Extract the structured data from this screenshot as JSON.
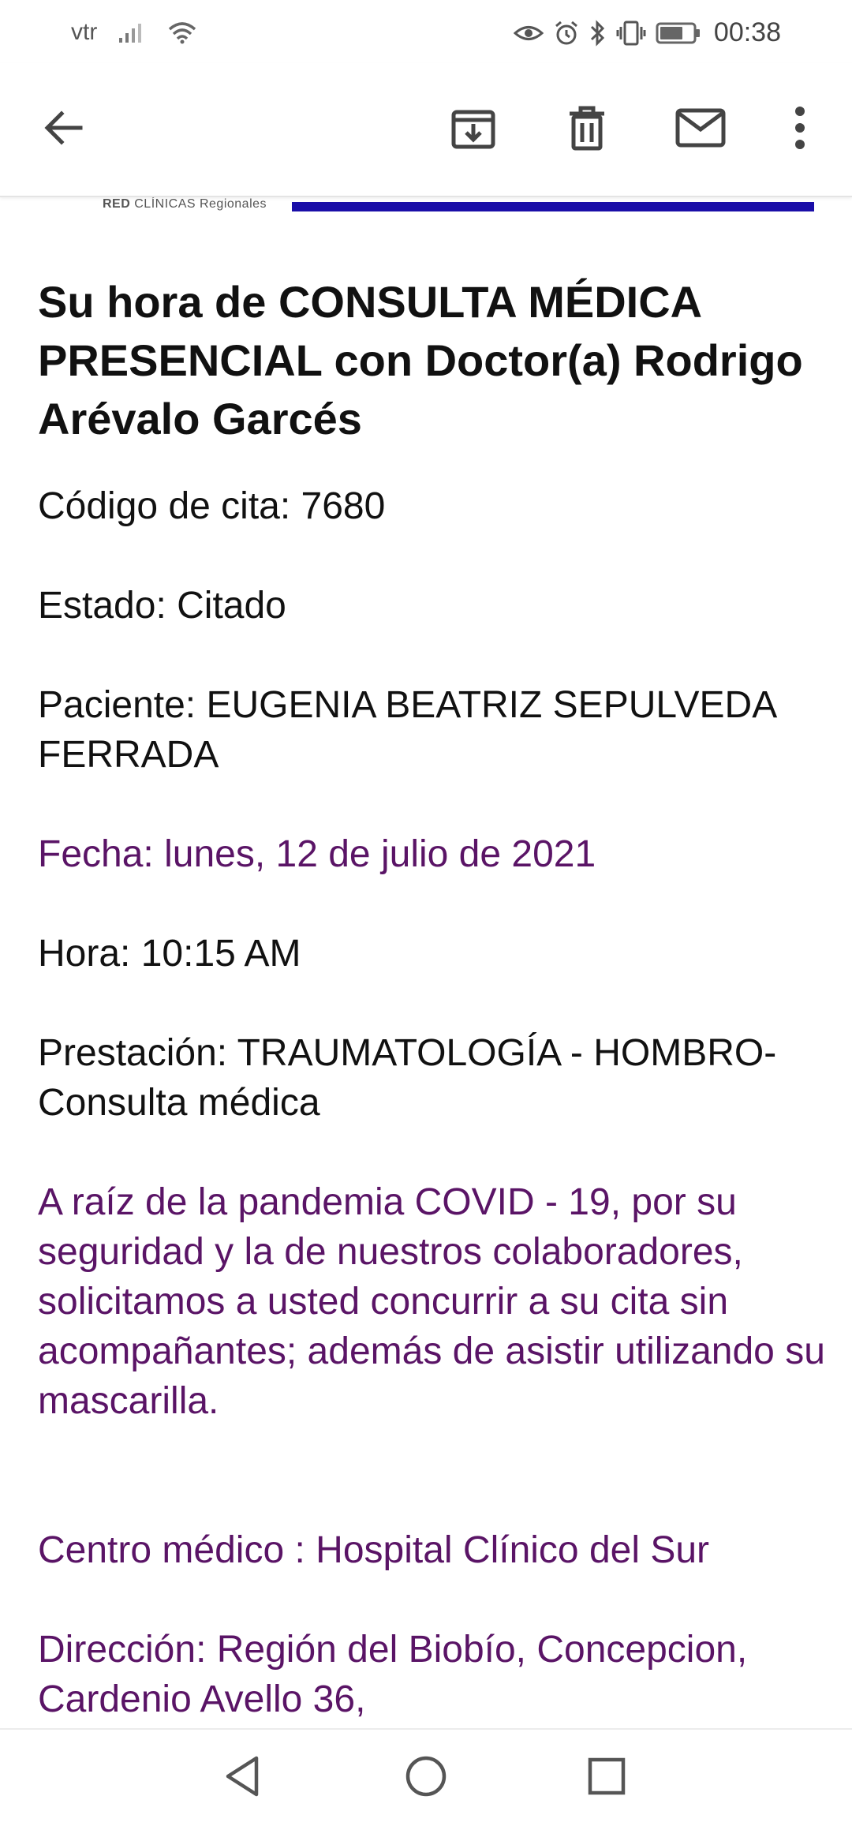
{
  "status_bar": {
    "carrier": "vtr",
    "time": "00:38",
    "icons": [
      "signal-icon",
      "wifi-icon",
      "eye-icon",
      "alarm-icon",
      "bluetooth-icon",
      "vibrate-icon",
      "battery-icon"
    ]
  },
  "toolbar": {
    "buttons": [
      "back-arrow-icon",
      "archive-icon",
      "delete-icon",
      "mark-unread-icon",
      "more-options-icon"
    ]
  },
  "email": {
    "logo_text_bold": "RED",
    "logo_text_light": "CLÍNICAS Regionales",
    "title": "Su hora de CONSULTA MÉDICA PRESENCIAL con Doctor(a) Rodrigo Arévalo Garcés",
    "fields": {
      "codigo": "Código de cita: 7680",
      "estado": "Estado: Citado",
      "paciente": "Paciente: EUGENIA BEATRIZ SEPULVEDA FERRADA",
      "fecha": "Fecha: lunes, 12 de julio de 2021",
      "hora": "Hora: 10:15 AM",
      "prestacion": "Prestación: TRAUMATOLOGÍA - HOMBRO-Consulta médica",
      "aviso": "A raíz de la pandemia COVID - 19, por su seguridad y la de nuestros colaboradores, solicitamos a usted concurrir a su cita sin acompañantes; además de asistir utilizando su mascarilla.",
      "centro": "Centro médico : Hospital Clínico del Sur",
      "direccion": "Dirección: Región del Biobío, Concepcion, Cardenio Avello 36,"
    }
  },
  "colors": {
    "link_purple": "#5a1466",
    "banner_blue": "#1a0ea8",
    "text": "#111111"
  },
  "nav_bar": {
    "buttons": [
      "back-triangle-icon",
      "home-circle-icon",
      "recents-square-icon"
    ]
  }
}
